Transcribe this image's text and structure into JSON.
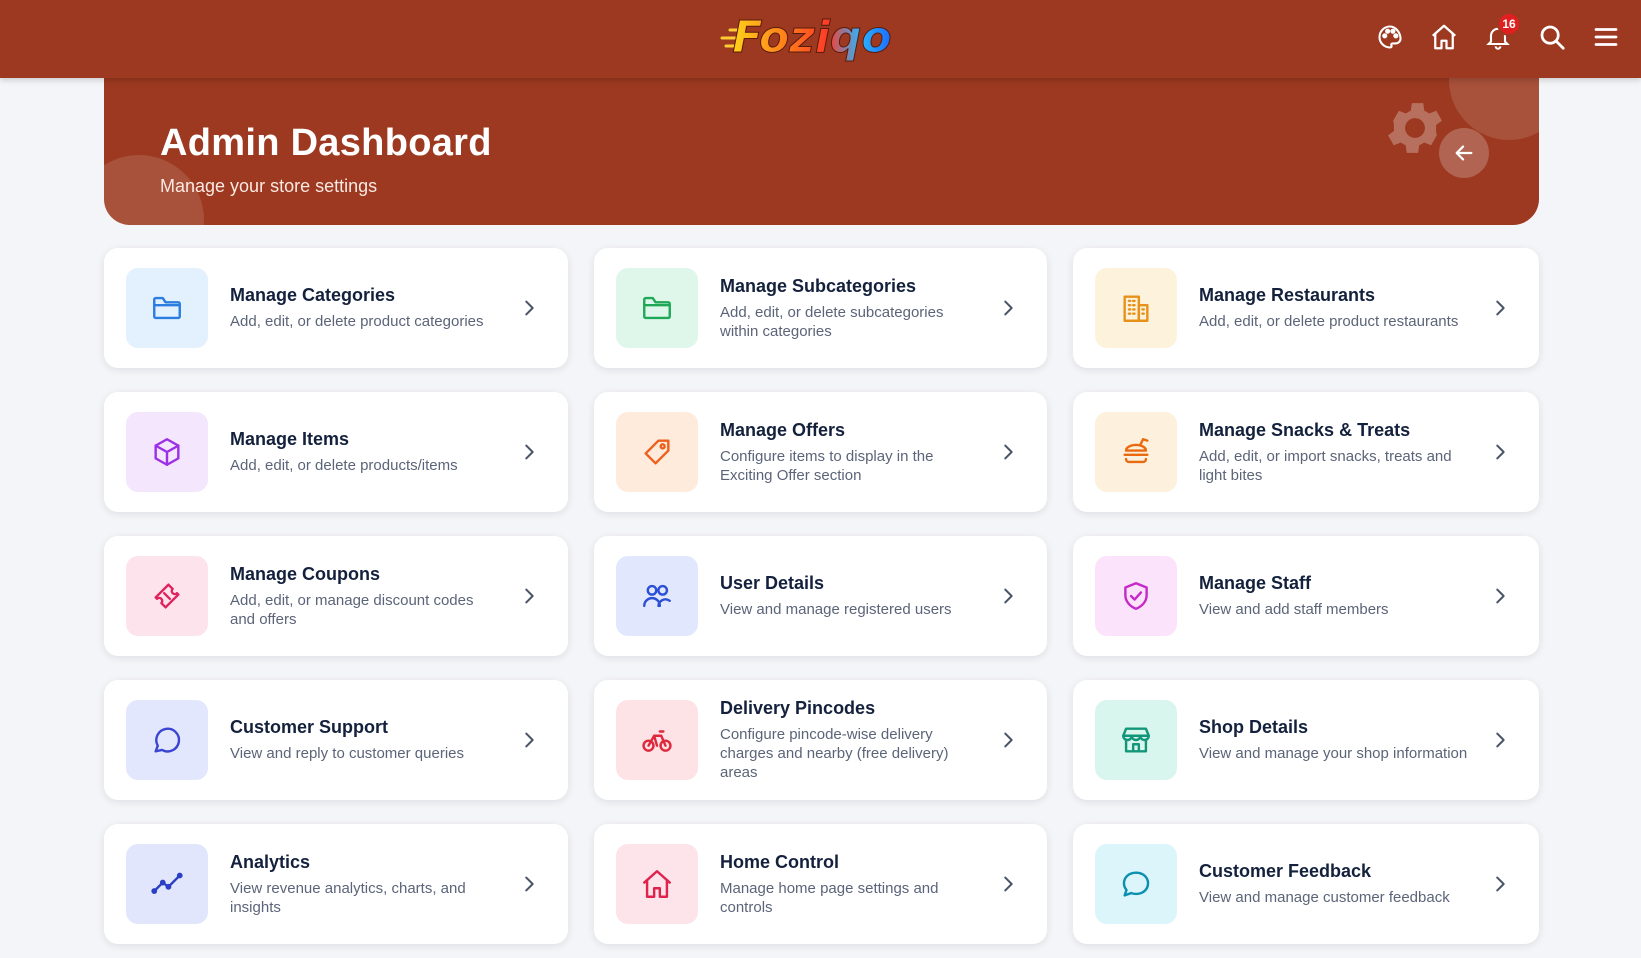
{
  "header": {
    "logo_text": "Foziqo",
    "notification_count": "16"
  },
  "banner": {
    "title": "Admin Dashboard",
    "subtitle": "Manage your store settings"
  },
  "cards": [
    {
      "title": "Manage Categories",
      "desc": "Add, edit, or delete product categories",
      "icon": "folder-icon",
      "bg": "#e3f0fd",
      "color": "#2b7de0"
    },
    {
      "title": "Manage Subcategories",
      "desc": "Add, edit, or delete subcategories within categories",
      "icon": "folder-icon",
      "bg": "#dff7ea",
      "color": "#1fa957"
    },
    {
      "title": "Manage Restaurants",
      "desc": "Add, edit, or delete product restaurants",
      "icon": "building-icon",
      "bg": "#fdf3dc",
      "color": "#e8911a"
    },
    {
      "title": "Manage Items",
      "desc": "Add, edit, or delete products/items",
      "icon": "box-icon",
      "bg": "#f3e6fd",
      "color": "#9b30e6"
    },
    {
      "title": "Manage Offers",
      "desc": "Configure items to display in the Exciting Offer section",
      "icon": "tag-icon",
      "bg": "#feebdc",
      "color": "#ee5f1e"
    },
    {
      "title": "Manage Snacks & Treats",
      "desc": "Add, edit, or import snacks, treats and light bites",
      "icon": "burger-icon",
      "bg": "#fdf0dc",
      "color": "#ea6a10"
    },
    {
      "title": "Manage Coupons",
      "desc": "Add, edit, or manage discount codes and offers",
      "icon": "ticket-icon",
      "bg": "#fde3ec",
      "color": "#e0225e"
    },
    {
      "title": "User Details",
      "desc": "View and manage registered users",
      "icon": "users-icon",
      "bg": "#e1e8fd",
      "color": "#2d4fd6"
    },
    {
      "title": "Manage Staff",
      "desc": "View and add staff members",
      "icon": "shield-check-icon",
      "bg": "#fbe3fb",
      "color": "#c52ac8"
    },
    {
      "title": "Customer Support",
      "desc": "View and reply to customer queries",
      "icon": "chat-icon",
      "bg": "#e3e7fd",
      "color": "#3a45d2"
    },
    {
      "title": "Delivery Pincodes",
      "desc": "Configure pincode-wise delivery charges and nearby (free delivery) areas",
      "icon": "bike-icon",
      "bg": "#fde3e6",
      "color": "#e0283d"
    },
    {
      "title": "Shop Details",
      "desc": "View and manage your shop information",
      "icon": "store-icon",
      "bg": "#d9f6ee",
      "color": "#12967a"
    },
    {
      "title": "Analytics",
      "desc": "View revenue analytics, charts, and insights",
      "icon": "trend-icon",
      "bg": "#e1e6fd",
      "color": "#2a3fc4"
    },
    {
      "title": "Home Control",
      "desc": "Manage home page settings and controls",
      "icon": "home-icon",
      "bg": "#fde3ea",
      "color": "#e0224d"
    },
    {
      "title": "Customer Feedback",
      "desc": "View and manage customer feedback",
      "icon": "message-icon",
      "bg": "#dbf5fb",
      "color": "#0a8fb0"
    }
  ]
}
